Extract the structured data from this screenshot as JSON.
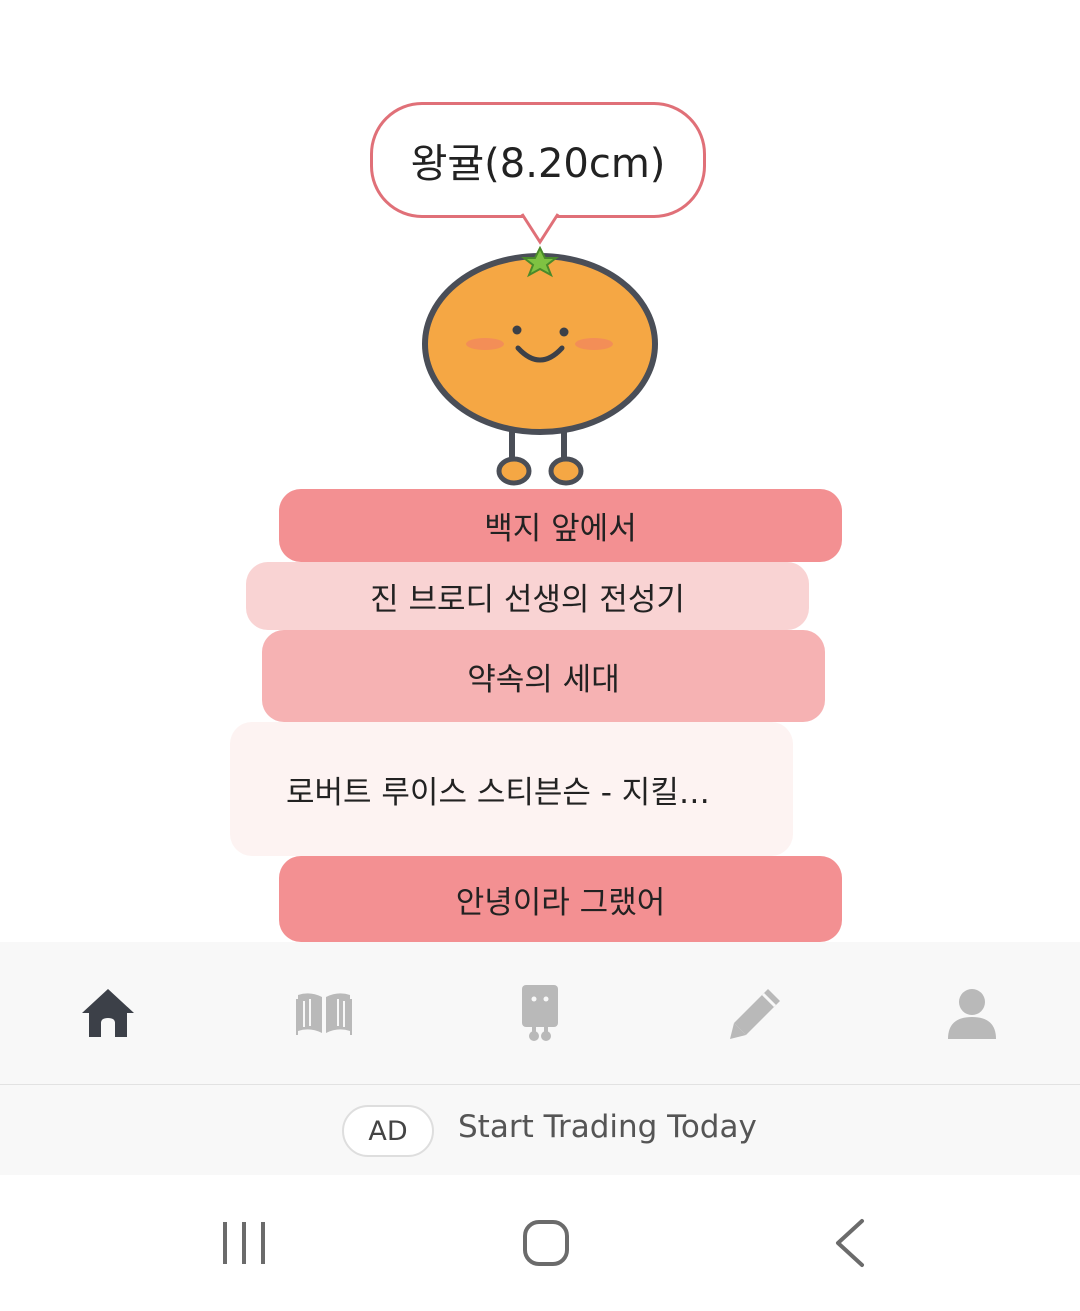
{
  "character": {
    "label": "왕귤(8.20cm)",
    "colors": {
      "body": "#f5a744",
      "outline": "#4a4e57",
      "bubble_border": "#e07078"
    }
  },
  "books": [
    {
      "title": "백지 앞에서",
      "color": "#f39092"
    },
    {
      "title": "진 브로디 선생의 전성기",
      "color": "#f9d3d3"
    },
    {
      "title": "약속의 세대",
      "color": "#f6b2b3"
    },
    {
      "title": "로버트 루이스 스티븐슨 - 지킬…",
      "color": "#fdf3f2"
    },
    {
      "title": "안녕이라 그랬어",
      "color": "#f39092"
    }
  ],
  "bottom_nav": {
    "items": [
      {
        "icon": "home-icon",
        "active": true
      },
      {
        "icon": "book-icon",
        "active": false
      },
      {
        "icon": "robot-icon",
        "active": false
      },
      {
        "icon": "pencil-icon",
        "active": false
      },
      {
        "icon": "profile-icon",
        "active": false
      }
    ],
    "active_color": "#3c4048",
    "inactive_color": "#b9b9b9"
  },
  "ad": {
    "badge": "AD",
    "text": "Start Trading Today"
  },
  "system_nav": {
    "icons": [
      "recent-apps-icon",
      "home-circle-icon",
      "back-icon"
    ]
  }
}
